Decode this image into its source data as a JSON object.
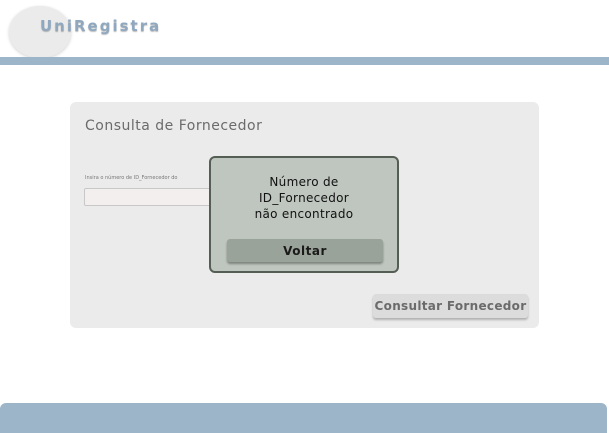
{
  "header": {
    "brand": "UniRegistra"
  },
  "card": {
    "title": "Consulta de Fornecedor",
    "field_label": "Insira o número de ID_Fornecedor do",
    "input_value": "",
    "consult_button": "Consultar Fornecedor"
  },
  "modal": {
    "message_lines": [
      "Número de",
      "ID_Fornecedor",
      "não encontrado"
    ],
    "button": "Voltar"
  },
  "colors": {
    "accent_bar": "#9cb5c9",
    "brand_text": "#8fa8c0",
    "modal_bg": "#bfc6bf",
    "modal_button": "#9aa39a"
  }
}
